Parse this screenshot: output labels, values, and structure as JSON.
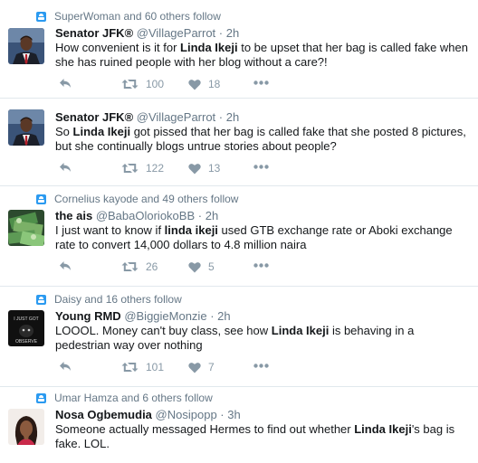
{
  "tweets": [
    {
      "context": "SuperWoman and 60 others follow",
      "name": "Senator JFK®",
      "handle": "@VillageParrot",
      "sep": "·",
      "time": "2h",
      "text": [
        {
          "t": "How convenient is it for "
        },
        {
          "b": "Linda Ikeji"
        },
        {
          "t": " to be upset that her bag is called fake when she has ruined people with her blog without a care?!"
        }
      ],
      "retweets": "100",
      "likes": "18",
      "avatar": "suit"
    },
    {
      "context": "",
      "name": "Senator JFK®",
      "handle": "@VillageParrot",
      "sep": "·",
      "time": "2h",
      "text": [
        {
          "t": "So "
        },
        {
          "b": "Linda Ikeji"
        },
        {
          "t": " got pissed that her bag is called fake that she posted 8 pictures, but she continually blogs untrue stories about people?"
        }
      ],
      "retweets": "122",
      "likes": "13",
      "avatar": "suit"
    },
    {
      "context": "Cornelius kayode and 49 others follow",
      "name": "the ais",
      "handle": "@BabaOloriokoBB",
      "sep": "·",
      "time": "2h",
      "text": [
        {
          "t": "I just want to know if "
        },
        {
          "b": "linda ikeji"
        },
        {
          "t": " used GTB exchange rate or Aboki exchange rate to convert 14,000 dollars to 4.8 million naira"
        }
      ],
      "retweets": "26",
      "likes": "5",
      "avatar": "money"
    },
    {
      "context": "Daisy and 16 others follow",
      "name": "Young RMD",
      "handle": "@BiggieMonzie",
      "sep": "·",
      "time": "2h",
      "text": [
        {
          "t": "LOOOL. Money can't buy class, see how "
        },
        {
          "b": "Linda Ikeji"
        },
        {
          "t": " is behaving in a pedestrian way over nothing"
        }
      ],
      "retweets": "101",
      "likes": "7",
      "avatar": "dark"
    },
    {
      "context": "Umar Hamza and 6 others follow",
      "name": "Nosa Ogbemudia",
      "handle": "@Nosipopp",
      "sep": "·",
      "time": "3h",
      "text": [
        {
          "t": "Someone actually messaged Hermes to find out whether "
        },
        {
          "b": "Linda Ikeji"
        },
        {
          "t": "'s bag is fake. LOL."
        }
      ],
      "retweets": "",
      "likes": "",
      "avatar": "woman"
    }
  ],
  "dark_avatar_text": [
    "I JUST GOT",
    "OBSERVE"
  ]
}
